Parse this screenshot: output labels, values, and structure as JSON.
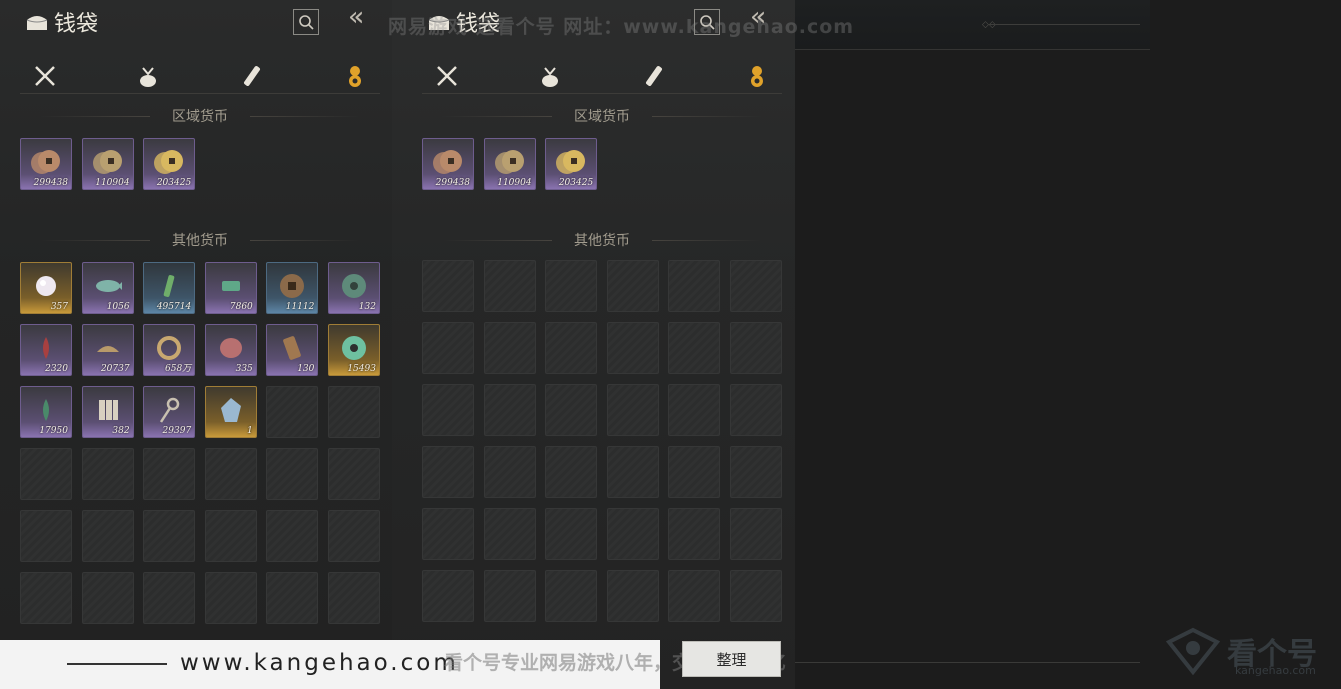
{
  "panel_title": "钱袋",
  "watermark_top": "网易游戏 选看个号   网址：www.kangehao.com",
  "sections": {
    "regional": "区域货币",
    "other": "其他货币"
  },
  "tabs": [
    {
      "name": "weapons-tab",
      "icon": "crossed-swords-icon"
    },
    {
      "name": "pouch-tab",
      "icon": "pouch-icon"
    },
    {
      "name": "scroll-tab",
      "icon": "scroll-icon"
    },
    {
      "name": "currency-tab",
      "icon": "coin-bag-icon",
      "active": true
    }
  ],
  "regional_currency": [
    {
      "count": "299438",
      "color": "#b98a6a"
    },
    {
      "count": "110904",
      "color": "#b9a070"
    },
    {
      "count": "203425",
      "color": "#d8b860"
    }
  ],
  "other_currency": [
    {
      "count": "357",
      "rarity": "gold",
      "icon": "pearl-icon"
    },
    {
      "count": "1056",
      "rarity": "purple",
      "icon": "jade-fish-icon"
    },
    {
      "count": "495714",
      "rarity": "blue",
      "icon": "green-token-icon"
    },
    {
      "count": "7860",
      "rarity": "purple",
      "icon": "jade-bar-icon"
    },
    {
      "count": "11112",
      "rarity": "blue",
      "icon": "copper-coin-icon"
    },
    {
      "count": "132",
      "rarity": "purple",
      "icon": "jade-coin-icon"
    },
    {
      "count": "2320",
      "rarity": "purple",
      "icon": "red-feather-icon"
    },
    {
      "count": "20737",
      "rarity": "purple",
      "icon": "ingot-icon"
    },
    {
      "count": "658万",
      "rarity": "purple",
      "icon": "coin-string-icon"
    },
    {
      "count": "335",
      "rarity": "purple",
      "icon": "stone-icon"
    },
    {
      "count": "130",
      "rarity": "purple",
      "icon": "bamboo-tag-icon"
    },
    {
      "count": "15493",
      "rarity": "gold",
      "icon": "jade-disc-icon"
    },
    {
      "count": "17950",
      "rarity": "purple",
      "icon": "green-feather-icon"
    },
    {
      "count": "382",
      "rarity": "purple",
      "icon": "talisman-icon"
    },
    {
      "count": "29397",
      "rarity": "purple",
      "icon": "key-icon"
    },
    {
      "count": "1",
      "rarity": "gold",
      "icon": "jade-stone-icon"
    }
  ],
  "footer": {
    "url": "www.kangehao.com",
    "promo": "看个号专业网易游戏八年，交易额过百亿",
    "sort_button": "整理",
    "logo_big": "看个号",
    "logo_small": "kangehao.com"
  },
  "colors": {
    "gold": "#c89a3a",
    "purple": "#8a73b0",
    "blue": "#5d86a6",
    "active_tab": "#e0a22a"
  }
}
